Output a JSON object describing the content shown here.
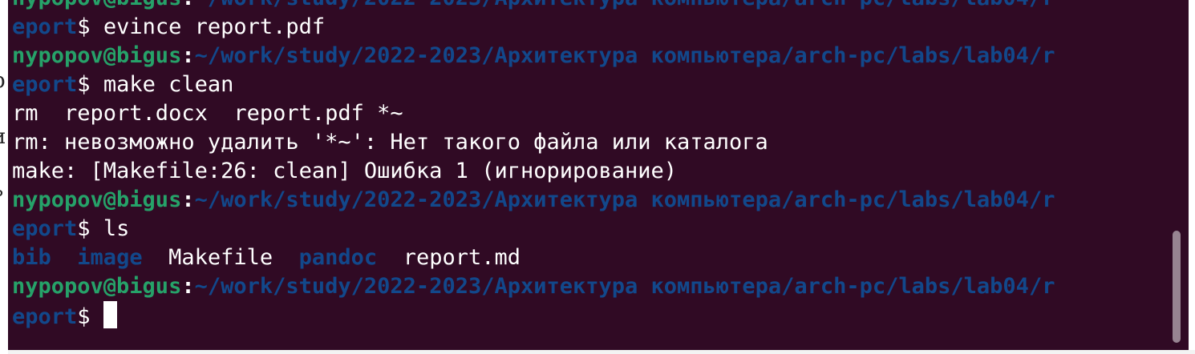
{
  "background_document": {
    "glyphs": [
      "р",
      "и",
      "ь"
    ]
  },
  "terminal": {
    "prompt": {
      "user_host": "nypopov@bigus",
      "colon": ":",
      "path_part1": "~/work/study/2022-2023/Архитектура компьютера/arch-pc/labs/lab04/r",
      "path_part2": "eport",
      "dollar": "$"
    },
    "commands": [
      "evince report.pdf",
      "make clean",
      "ls"
    ],
    "output": {
      "make_clean_lines": [
        "rm  report.docx  report.pdf *~",
        "rm: невозможно удалить '*~': Нет такого файла или каталога",
        "make: [Makefile:26: clean] Ошибка 1 (игнорирование)"
      ],
      "ls_entries": [
        "bib",
        "image",
        "Makefile",
        "pandoc",
        "report.md"
      ]
    },
    "colors": {
      "background": "#300a24",
      "user_host": "#26a269",
      "path": "#12488b",
      "text": "#ffffff"
    }
  }
}
